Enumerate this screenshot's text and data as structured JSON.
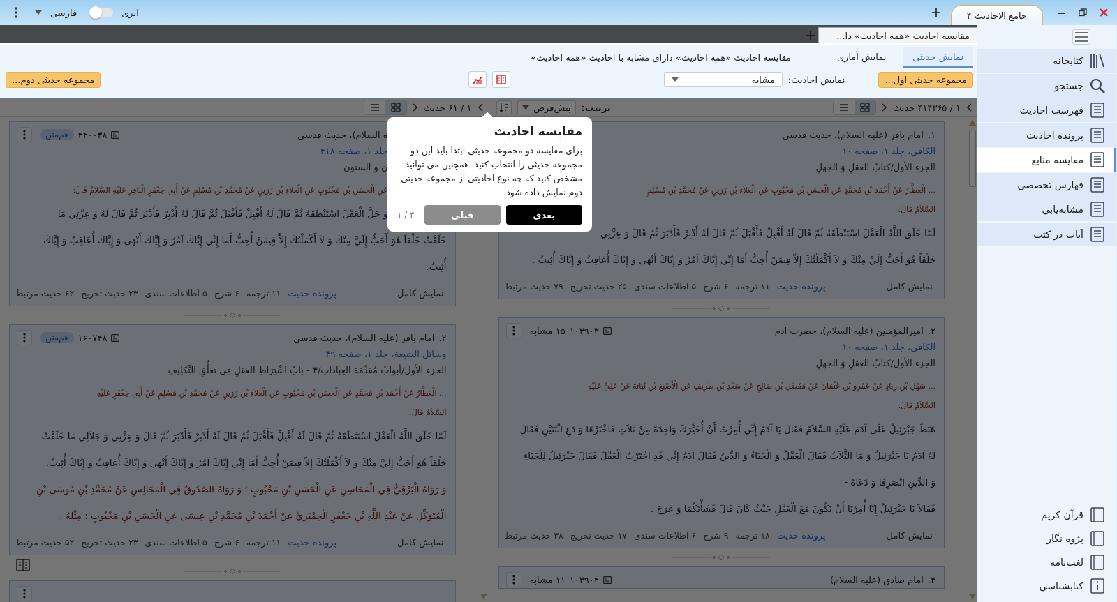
{
  "title_bar": {
    "app_tab": "جامع الاحادیث ۴",
    "cloud_label": "ابری",
    "cloud_sync": {
      "on": false
    },
    "language": "فارسی"
  },
  "doc_tabs": [
    {
      "label": "مقایسه احادیث «همه احادیث» دا...",
      "selected": true
    }
  ],
  "view_tabs": [
    {
      "label": "نمایش حدیثی",
      "selected": true
    },
    {
      "label": "نمایش آماری",
      "selected": false
    }
  ],
  "page_title": "مقایسه احادیث «همه احادیث» دارای مشابه با احادیث «همه احادیث»",
  "first_collection_button": "مجموعه حدیثی اول...",
  "filter": {
    "label": "نمایش احادیث:",
    "value": "مشابه"
  },
  "second_collection_button": "مجموعه حدیثی دوم...",
  "panes": [
    {
      "pager": "۱ / ۴۱۴۳۶۵ حدیث",
      "view_modes": [
        {
          "selected": true
        },
        {
          "selected": false
        }
      ],
      "sort": {
        "label": "ترتیب:",
        "value": "پیش‌فرض"
      },
      "cards": [
        {
          "number": "۱.",
          "narrator": "امام باقر (علیه السلام)، حدیث قدسی",
          "source": "الکافي، جلد ۱، صفحه ۱۰",
          "chapter": "الجزء الأول/کتابُ العَقلِ وَ الجَهلِ",
          "chain": [
            "... الْعَطَّارُ عَنْ أَحْمَدَ بْنِ مُحَمَّدٍ عَنِ الْحَسَنِ بْنِ مَحْبُوبٍ عَنِ الْعَلاَءِ بْنِ رَزِينٍ عَنْ مُحَمَّدِ بْنِ مُسْلِمٍ",
            "السَّلاَمُ قَالَ:"
          ],
          "text": [
            {
              "kind": "matn",
              "text": "لَمَّا خَلَقَ اللَّهُ الْعَقْلَ اسْتَنْطَقَهُ ثُمَّ قَالَ لَهُ أَقْبِلْ فَأَقْبَلَ ثُمَّ قَالَ لَهُ أَدْبِرْ فَأَدْبَرَ ثُمَّ قَالَ وَ عِزَّتِي"
            },
            {
              "kind": "matn",
              "text": "خَلْقاً هُوَ أَحَبُّ إِلَيَّ مِنْكَ وَ لاَ أَكْمَلْتُكَ إِلاَّ فِيمَنْ أُحِبُّ أَمَا إِنِّي إِيَّاكَ آمُرُ وَ إِيَّاكَ أَنْهَى وَ إِيَّاكَ أُعَاقِبُ وَ إِيَّاكَ أُثِيبُ ."
            }
          ],
          "full_view": "نمایش کامل",
          "file_link": "پرونده حدیث",
          "stats": [
            "۱۱ ترجمه",
            "۶ شرح",
            "۵ اطلاعات سندی",
            "۲۵ حدیث تخریج",
            "۷۹ حدیث مرتبط"
          ]
        },
        {
          "number": "۲.",
          "narrator": "امیرالمؤمنین (علیه السلام)، حضرت آدم",
          "id": "۱۰۳۹۰۳",
          "similar": "۱۵ مشابه",
          "menu": true,
          "source": "الکافي، جلد ۱، صفحه ۱۰",
          "chapter": "الجزء الأول/کتابُ العَقلِ وَ الجَهلِ",
          "chain": [
            "... سَهْلِ بْنِ زِيَادٍ عَنْ عَمْرِو بْنِ عُثْمَانَ عَنْ مُفَضَّلِ بْنِ صَالِحٍ عَنْ سَعْدِ بْنِ طَرِيفٍ عَنِ الْأَصْبَغِ بْنِ نُبَاتَةَ عَنْ عَلِيٍّ عَلَيْهِ",
            "السَّلاَمُ قَالَ:"
          ],
          "text": [
            {
              "kind": "matn",
              "text": "هَبَطَ جَبْرَئِيلُ عَلَى آدَمَ عَلَيْهِ السَّلاَمُ فَقَالَ يَا آدَمُ إِنِّي أُمِرْتُ أَنْ أُخَيِّرَكَ وَاحِدَةً مِنْ ثَلاَثٍ فَاخْتَرْهَا وَ دَعِ اثْنَتَيْنِ فَقَالَ"
            },
            {
              "kind": "matn",
              "text": "لَهُ آدَمُ يَا جَبْرَئِيلُ وَ مَا الثَّلاَثُ فَقَالَ الْعَقْلُ وَ الْحَيَاءُ وَ الدِّينُ فَقَالَ آدَمُ إِنِّي قَدِ اخْتَرْتُ الْعَقْلَ فَقَالَ جَبْرَئِيلُ لِلْحَيَاءِ"
            },
            {
              "kind": "matn",
              "text": "وَ الدِّينِ انْصَرِفَا وَ دَعَاهُ -"
            },
            {
              "kind": "matn",
              "text": "فَقَالاَ يَا جَبْرَئِيلُ إِنَّا أُمِرْنَا أَنْ نَكُونَ مَعَ الْعَقْلِ حَيْثُ كَانَ قَالَ فَشَأْنَكُمَا وَ عَرَجَ ."
            }
          ],
          "full_view": "نمایش کامل",
          "file_link": "پرونده حدیث",
          "stats": [
            "۱۸ ترجمه",
            "۹ شرح",
            "۶ اطلاعات سندی",
            "۱۷ حدیث تخریج",
            "۳۸ حدیث مرتبط"
          ]
        },
        {
          "number": "۳.",
          "narrator": "امام صادق (علیه السلام)",
          "id": "۱۰۳۹۰۴",
          "similar": "۱۱ مشابه",
          "menu": true
        }
      ]
    },
    {
      "pager": "۱ / ۶۱ حدیث",
      "view_modes": [
        {
          "selected": true
        },
        {
          "selected": false
        }
      ],
      "cards": [
        {
          "narrator": "ه السلام)، حدیث قدسی",
          "id": "۴۴۰۰۳۸",
          "badge": "هم‌متن",
          "menu": true,
          "source": "جلد ۱، صفحه ۴۱۸",
          "chapter": "ن و الستون",
          "chain": [
            "عَنِ الْحَسَنِ بْنِ مَحْبُوبٍ عَنِ الْعَلاَءِ بْنِ رَزِينٍ عَنْ مُحَمَّدِ بْنِ مُسْلِمٍ عَنْ أَبِي جَعْفَرٍ الْبَاقِرِ عَلَيْهِ السَّلاَمُ قَالَ:"
          ],
          "text": [
            {
              "kind": "matn",
              "text": "وَ جَلَّ الْعَقْلَ اسْتَنْطَقَهُ ثُمَّ قَالَ لَهُ أَقْبِلْ فَأَقْبَلَ ثُمَّ قَالَ لَهُ أَدْبِرْ فَأَدْبَرَ ثُمَّ قَالَ لَهُ وَ عِزَّتِي مَا"
            },
            {
              "kind": "matn",
              "text": "خَلَقْتُ خَلْقاً هُوَ أَحَبُّ إِلَيَّ مِنْكَ وَ لاَ أَكْمَلْتُكَ إِلاَّ فِيمَنْ أُحِبُّ أَمَا إِنِّي إِيَّاكَ آمُرُ وَ إِيَّاكَ أَنْهَى وَ إِيَّاكَ أُعَاقِبُ وَ إِيَّاكَ"
            },
            {
              "kind": "matn",
              "text": "أُثِيبُ."
            }
          ],
          "full_view": "نمایش کامل",
          "file_link": "پرونده حدیث",
          "stats": [
            "۱۱ ترجمه",
            "۶ شرح",
            "۵ اطلاعات سندی",
            "۲۳ حدیث تخریج",
            "۶۲ حدیث مرتبط"
          ]
        },
        {
          "number": "۲.",
          "narrator": "امام باقر (علیه السلام)، حدیث قدسی",
          "id": "۱۶۰۷۴۸",
          "badge": "هم‌متن",
          "menu": true,
          "book_icon": true,
          "source": "وسائل الشيعة، جلد ۱، صفحه ۳۹",
          "chapter": "الجزء الأول/أبوابُ مُقدِّمَة العِباداتِ/۳ - بَابُ اشْتِرَاطِ العَقلِ فِي تَعَلُّقِ التَّكلِيفِ",
          "chain": [
            "... الْعَطَّارُ عَنْ أَحْمَدَ بْنِ مُحَمَّدٍ عَنِ الْحَسَنِ بْنِ مَحْبُوبٍ عَنِ الْعَلاَءِ بْنِ رَزِينٍ عَنْ مُحَمَّدِ بْنِ مُسْلِمٍ عَنْ أَبِي جَعْفَرٍ عَلَيْهِ",
            "السَّلاَمُ قَالَ:"
          ],
          "text": [
            {
              "kind": "matn",
              "text": "لَمَّا خَلَقَ اللَّهُ الْعَقْلَ اسْتَنْطَقَهُ ثُمَّ قَالَ لَهُ أَقْبِلْ فَأَقْبَلَ ثُمَّ قَالَ لَهُ أَدْبِرْ فَأَدْبَرَ ثُمَّ قَالَ وَ عِزَّتِي وَ جَلاَلِي مَا خَلَقْتُ"
            },
            {
              "kind": "matn",
              "text": "خَلْقاً هُوَ أَحَبُّ إِلَيَّ مِنْكَ وَ لاَ أَكْمَلْتُكَ إِلاَّ فِيمَنْ أُحِبُّ أَمَا إِنِّي إِيَّاكَ آمُرُ وَ إِيَّاكَ أَنْهَى وَ إِيَّاكَ أُعَاقِبُ وَ إِيَّاكَ أُثِيبُ."
            },
            {
              "kind": "note",
              "text": "وَ رَوَاهُ الْبَرْقِيُّ فِي الْمَحَاسِنِ عَنِ الْحَسَنِ بْنِ مَحْبُوبٍ ؛ وَ رَوَاهُ الصَّدُوقُ فِي الْمَجَالِسِ عَنْ مُحَمَّدِ بْنِ مُوسَى بْنِ"
            },
            {
              "kind": "note",
              "text": "الْمُتَوَكِّلِ عَنْ عَبْدِ اللَّهِ بْنِ جَعْفَرٍ الْحِمْيَرِيِّ عَنْ أَحْمَدَ بْنِ مُحَمَّدِ بْنِ عِيسَى عَنِ الْحَسَنِ بْنِ مَحْبُوبٍ : مِثْلَهُ ."
            }
          ],
          "full_view": "نمایش کامل",
          "file_link": "پرونده حدیث",
          "stats": [
            "۱۱ ترجمه",
            "۶ شرح",
            "۵ اطلاعات سندی",
            "۲۳ حدیث تخریج",
            "۵۲ حدیث مرتبط"
          ]
        },
        {
          "menu": true
        }
      ]
    }
  ],
  "popup": {
    "title": "مقایسه احادیث",
    "body": "برای مقایسه دو مجموعه حدیثی ابتدا باید این دو مجموعه حدیثی را انتخاب کنید. همچنین می توانید مشخص کنید که چه نوع احادیثی از مجموعه حدیثی دوم نمایش داده شود.",
    "next": "بعدی",
    "prev": "قبلی",
    "counter": "۱ / ۳"
  },
  "sidebar": {
    "items": [
      {
        "label": "کتابخانه",
        "selected": false
      },
      {
        "label": "جستجو",
        "selected": false
      },
      {
        "label": "فهرست احادیث",
        "selected": false
      },
      {
        "label": "پرونده احادیث",
        "selected": false
      },
      {
        "label": "مقایسه منابع",
        "selected": true
      },
      {
        "label": "فهارس تخصصی",
        "selected": false
      },
      {
        "label": "مشابه‌یابی",
        "selected": false
      },
      {
        "label": "آیات در کتب",
        "selected": false
      }
    ],
    "bottom_items": [
      "قرآن کریم",
      "پژوه نگار",
      "لغت‌نامه",
      "کتابشناسی"
    ]
  }
}
